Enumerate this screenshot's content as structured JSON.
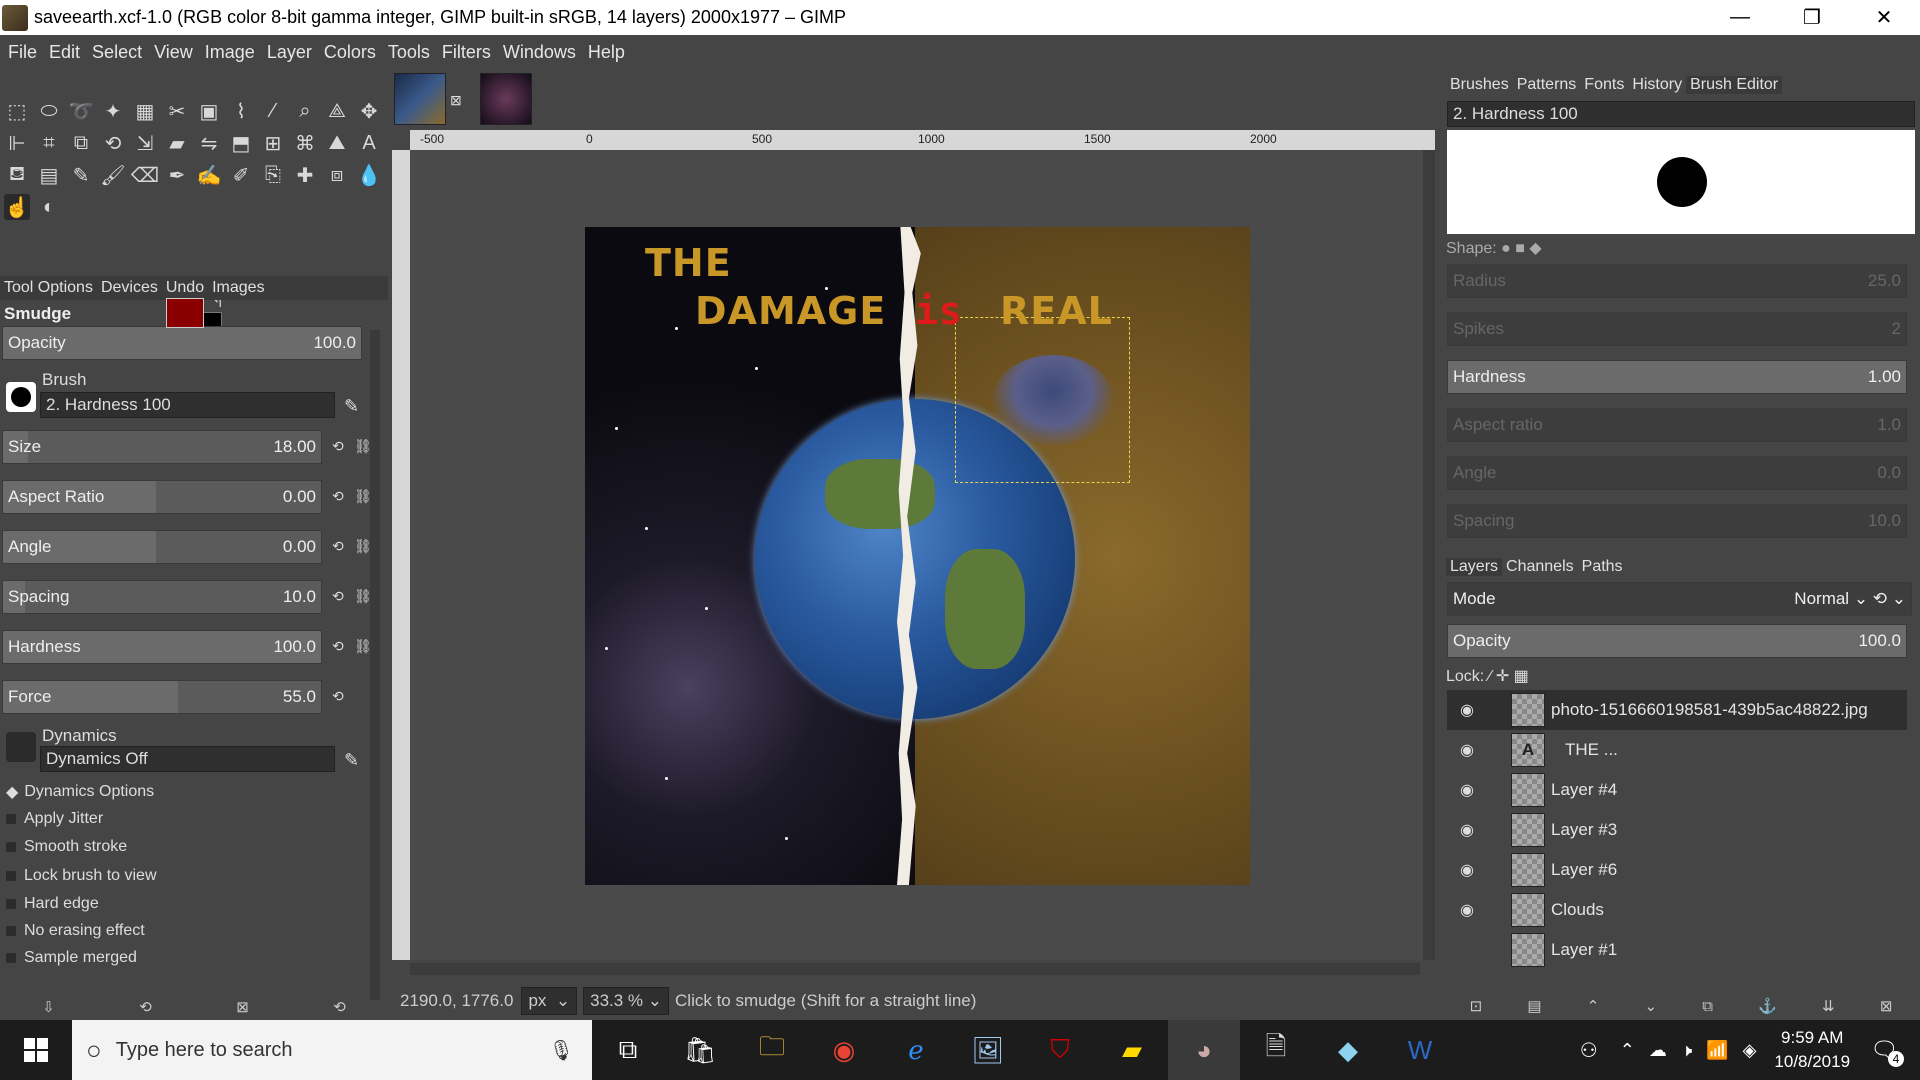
{
  "window": {
    "title": "saveearth.xcf-1.0 (RGB color 8-bit gamma integer, GIMP built-in sRGB, 14 layers) 2000x1977 – GIMP",
    "minimize": "—",
    "maximize": "❐",
    "close": "✕"
  },
  "menu": [
    "File",
    "Edit",
    "Select",
    "View",
    "Image",
    "Layer",
    "Colors",
    "Tools",
    "Filters",
    "Windows",
    "Help"
  ],
  "tool_options": {
    "tabs": [
      "Tool Options",
      "Devices",
      "Undo",
      "Images"
    ],
    "tool_name": "Smudge",
    "opacity_label": "Opacity",
    "opacity_value": "100.0",
    "brush_label": "Brush",
    "brush_value": "2. Hardness 100",
    "size_label": "Size",
    "size_value": "18.00",
    "aspect_label": "Aspect Ratio",
    "aspect_value": "0.00",
    "angle_label": "Angle",
    "angle_value": "0.00",
    "spacing_label": "Spacing",
    "spacing_value": "10.0",
    "hardness_label": "Hardness",
    "hardness_value": "100.0",
    "force_label": "Force",
    "force_value": "55.0",
    "dynamics_label": "Dynamics",
    "dynamics_value": "Dynamics Off",
    "dyn_options": "Dynamics Options",
    "checks": [
      "Apply Jitter",
      "Smooth stroke",
      "Lock brush to view",
      "Hard edge",
      "No erasing effect",
      "Sample merged"
    ]
  },
  "colors": {
    "foreground": "#8a0000",
    "background": "#000000"
  },
  "ruler": {
    "h": [
      "-500",
      "0",
      "500",
      "1000",
      "1500",
      "2000"
    ]
  },
  "image_text": {
    "the": "THE",
    "damage": "DAMAGE",
    "is": "is",
    "real": "REAL"
  },
  "status": {
    "coords": "2190.0, 1776.0",
    "unit": "px",
    "zoom": "33.3 %",
    "hint": "Click to smudge (Shift for a straight line)"
  },
  "brush_dock": {
    "tabs": [
      "Brushes",
      "Patterns",
      "Fonts",
      "History",
      "Brush Editor"
    ],
    "brush_name": "2. Hardness 100",
    "shape_label": "Shape:",
    "radius_label": "Radius",
    "radius_value": "25.0",
    "spikes_label": "Spikes",
    "spikes_value": "2",
    "hardness_label": "Hardness",
    "hardness_value": "1.00",
    "aspect_label": "Aspect ratio",
    "aspect_value": "1.0",
    "angle_label": "Angle",
    "angle_value": "0.0",
    "spacing_label": "Spacing",
    "spacing_value": "10.0"
  },
  "layers_dock": {
    "tabs": [
      "Layers",
      "Channels",
      "Paths"
    ],
    "mode_label": "Mode",
    "mode_value": "Normal",
    "opacity_label": "Opacity",
    "opacity_value": "100.0",
    "lock_label": "Lock:",
    "layers": [
      {
        "name": "photo-1516660198581-439b5ac48822.jpg"
      },
      {
        "name": "THE  ..."
      },
      {
        "name": "Layer #4"
      },
      {
        "name": "Layer #3"
      },
      {
        "name": "Layer #6"
      },
      {
        "name": "Clouds"
      },
      {
        "name": "Layer #1"
      }
    ]
  },
  "taskbar": {
    "search_placeholder": "Type here to search",
    "time": "9:59 AM",
    "date": "10/8/2019",
    "notif_count": "4"
  }
}
